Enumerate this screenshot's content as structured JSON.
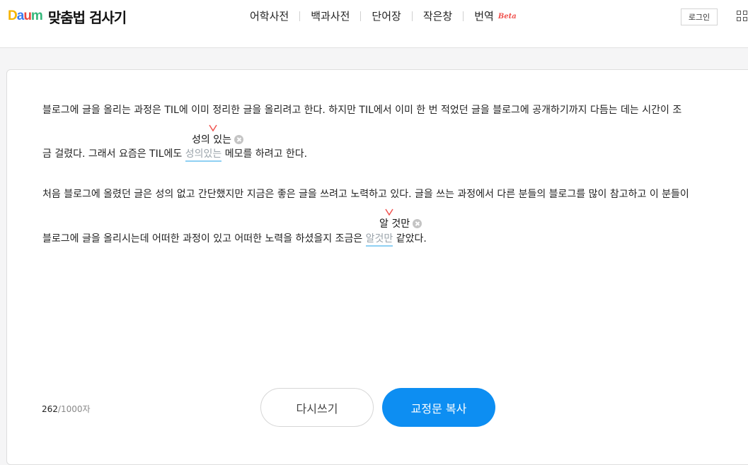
{
  "header": {
    "logo_text": "Daum",
    "title": "맞춤법 검사기",
    "nav": [
      {
        "label": "어학사전"
      },
      {
        "label": "백과사전"
      },
      {
        "label": "단어장"
      },
      {
        "label": "작은창"
      },
      {
        "label": "번역",
        "badge": "Beta"
      }
    ],
    "login_label": "로그인",
    "menu_icon": "grid-icon"
  },
  "editor": {
    "line1": "블로그에 글을 올리는 과정은 TIL에 이미 정리한 글을 올리려고 한다. 하지만 TIL에서 이미 한 번 적었던 글을 블로그에 공개하기까지 다듬는 데는 시간이 조",
    "line2_before": "금 걸렸다. 그래서 요즘은 TIL에도 ",
    "line2_error": "성의있는",
    "line2_after": " 메모를 하려고 한다.",
    "suggestion1": "성의 있는",
    "line3": "처음 블로그에 올렸던 글은 성의 없고 간단했지만 지금은 좋은 글을 쓰려고 노력하고 있다. 글을 쓰는 과정에서 다른 분들의 블로그를 많이 참고하고 이 분들이",
    "line4_before": "블로그에 글을 올리시는데 어떠한 과정이 있고 어떠한 노력을 하셨을지 조금은 ",
    "line4_error": "알것만",
    "line4_after": " 같았다.",
    "suggestion2": "알 것만"
  },
  "footer": {
    "char_count": "262",
    "char_max": "/1000자",
    "reset_label": "다시쓰기",
    "copy_label": "교정문 복사"
  },
  "colors": {
    "accent": "#0d8ef2",
    "error_underline": "#8fd0f3",
    "beta": "#f0534f"
  }
}
